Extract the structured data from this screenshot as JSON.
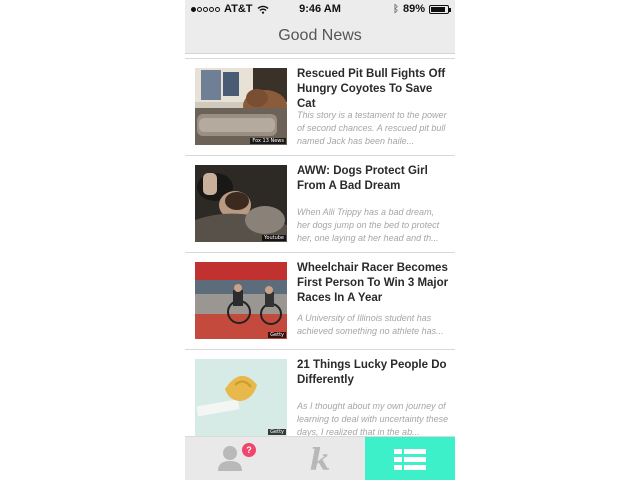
{
  "status_bar": {
    "carrier": "AT&T",
    "time": "9:46 AM",
    "battery_label": "89%",
    "battery_level": 0.89,
    "signal_dots_filled": 1,
    "signal_dots_total": 5
  },
  "nav": {
    "title": "Good News"
  },
  "articles": [
    {
      "title": "Rescued Pit Bull Fights Off Hungry Coyotes To Save Cat",
      "summary": "This story is a testament to the power of second chances. A rescued pit bull named Jack has been haile...",
      "credit": "Fox 13 News"
    },
    {
      "title": "AWW: Dogs Protect Girl From A Bad Dream",
      "summary": "When Alli Trippy has a bad dream, her dogs jump on the bed to protect her, one laying at her head and th...",
      "credit": "Youtube"
    },
    {
      "title": "Wheelchair Racer Becomes First Person To Win 3 Major Races In A Year",
      "summary": "A University of Illinois student has achieved something no athlete has...",
      "credit": "Getty"
    },
    {
      "title": "21 Things Lucky People Do Differently",
      "summary": "As I thought about my own journey of learning to deal with uncertainty these days, I realized that in the ab...",
      "credit": "Getty"
    }
  ],
  "tab_bar": {
    "notification_count": "?",
    "tabs": [
      "profile",
      "kindness",
      "news-feed"
    ],
    "active_tab": "news-feed",
    "active_color": "#3ef0c9",
    "badge_color": "#f0466b"
  }
}
